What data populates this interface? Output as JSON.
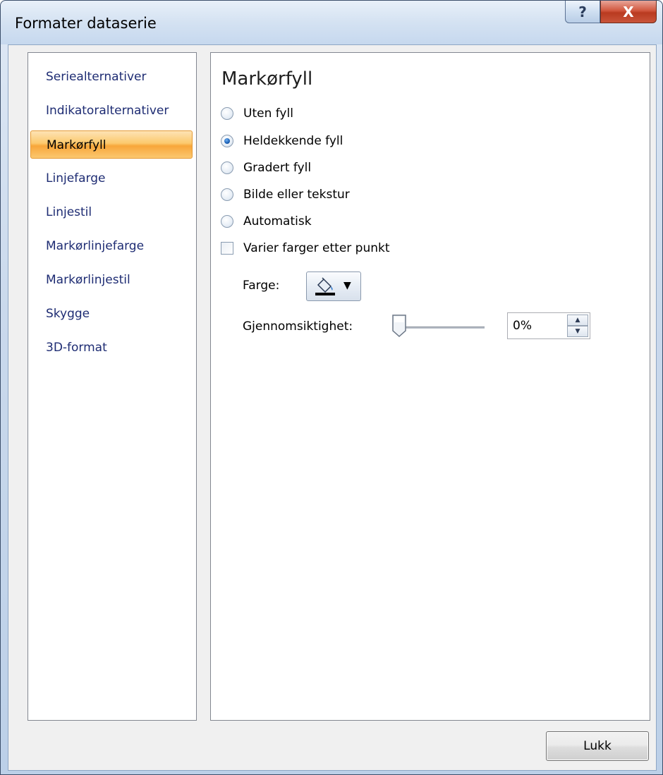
{
  "window": {
    "title": "Formater dataserie",
    "help_glyph": "?",
    "close_glyph": "X"
  },
  "nav": {
    "items": [
      {
        "label": "Seriealternativer",
        "selected": false
      },
      {
        "label": "Indikatoralternativer",
        "selected": false
      },
      {
        "label": "Markørfyll",
        "selected": true
      },
      {
        "label": "Linjefarge",
        "selected": false
      },
      {
        "label": "Linjestil",
        "selected": false
      },
      {
        "label": "Markørlinjefarge",
        "selected": false
      },
      {
        "label": "Markørlinjestil",
        "selected": false
      },
      {
        "label": "Skygge",
        "selected": false
      },
      {
        "label": "3D-format",
        "selected": false
      }
    ]
  },
  "panel": {
    "title": "Markørfyll",
    "fill_options": [
      {
        "label": "Uten fyll",
        "checked": false
      },
      {
        "label": "Heldekkende fyll",
        "checked": true
      },
      {
        "label": "Gradert fyll",
        "checked": false
      },
      {
        "label": "Bilde eller tekstur",
        "checked": false
      },
      {
        "label": "Automatisk",
        "checked": false
      }
    ],
    "vary_colors": {
      "label": "Varier farger etter punkt",
      "checked": false
    },
    "color_label": "Farge:",
    "transparency_label": "Gjennomsiktighet:",
    "transparency_value": "0%",
    "transparency_level": 0
  },
  "footer": {
    "close_label": "Lukk"
  }
}
